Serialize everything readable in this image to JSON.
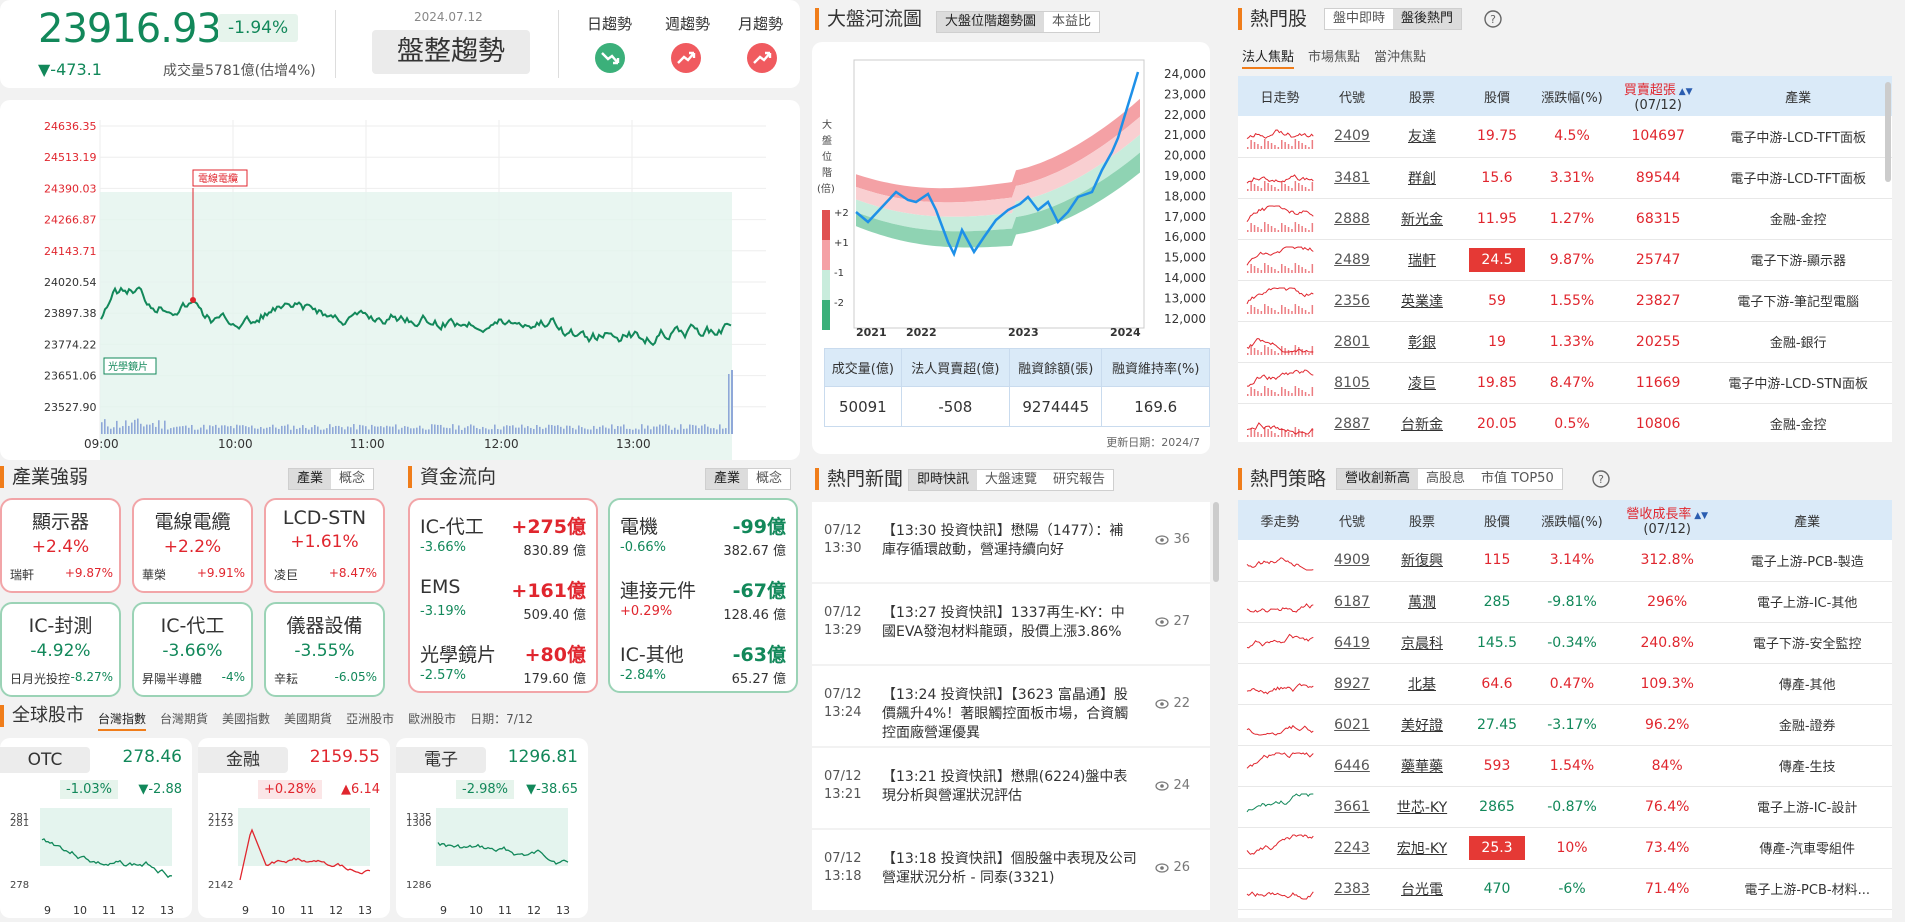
{
  "market": {
    "index": "23916.93",
    "pct": "-1.94%",
    "change": "▼-473.1",
    "volume": "成交量5781億(估增4%)",
    "date": "2024.07.12",
    "trend_label": "盤整趨勢",
    "trends": [
      {
        "label": "日趨勢",
        "dir": "down",
        "color": "#3bb07a"
      },
      {
        "label": "週趨勢",
        "dir": "up",
        "color": "#f05a5f"
      },
      {
        "label": "月趨勢",
        "dir": "up",
        "color": "#f05a5f"
      }
    ]
  },
  "intraday": {
    "y_ticks": [
      "24636.35",
      "24513.19",
      "24390.03",
      "24266.87",
      "24143.71",
      "24020.54",
      "23897.38",
      "23774.22",
      "23651.06",
      "23527.90"
    ],
    "x_ticks": [
      "09:00",
      "10:00",
      "11:00",
      "12:00",
      "13:00"
    ],
    "tag1": "電線電纜",
    "tag2": "光學鏡片"
  },
  "river": {
    "title": "大盤河流圖",
    "tabs": [
      "大盤位階趨勢圖",
      "本益比"
    ],
    "y_ticks": [
      "24,000",
      "23,000",
      "22,000",
      "21,000",
      "20,000",
      "19,000",
      "18,000",
      "17,000",
      "16,000",
      "15,000",
      "14,000",
      "13,000",
      "12,000"
    ],
    "x_ticks": [
      "2021",
      "2022",
      "2023",
      "2024"
    ],
    "legend_title": "大盤位階(倍)",
    "legend": [
      "+2",
      "+1",
      "-1",
      "-2"
    ],
    "table_head": [
      "成交量(億)",
      "法人買賣超(億)",
      "融資餘額(張)",
      "融資維持率(%)"
    ],
    "table_vals": [
      "50091",
      "-508",
      "9274445",
      "169.6"
    ],
    "update": "更新日期：2024/7"
  },
  "hot": {
    "title": "熱門股",
    "tabs": [
      "盤中即時",
      "盤後熱門"
    ],
    "subtabs": [
      "法人焦點",
      "市場焦點",
      "當沖焦點"
    ],
    "head": [
      "日走勢",
      "代號",
      "股票",
      "股價",
      "漲跌幅(%)",
      "買賣超張",
      "(07/12)",
      "產業"
    ],
    "rows": [
      [
        "2409",
        "友達",
        "19.75",
        "4.5%",
        "104697",
        "電子中游-LCD-TFT面板"
      ],
      [
        "3481",
        "群創",
        "15.6",
        "3.31%",
        "89544",
        "電子中游-LCD-TFT面板"
      ],
      [
        "2888",
        "新光金",
        "11.95",
        "1.27%",
        "68315",
        "金融-金控"
      ],
      [
        "2489",
        "瑞軒",
        "24.5",
        "9.87%",
        "25747",
        "電子下游-顯示器"
      ],
      [
        "2356",
        "英業達",
        "59",
        "1.55%",
        "23827",
        "電子下游-筆記型電腦"
      ],
      [
        "2801",
        "彰銀",
        "19",
        "1.33%",
        "20255",
        "金融-銀行"
      ],
      [
        "8105",
        "凌巨",
        "19.85",
        "8.47%",
        "11669",
        "電子中游-LCD-STN面板"
      ],
      [
        "2887",
        "台新金",
        "20.05",
        "0.5%",
        "10806",
        "金融-金控"
      ]
    ]
  },
  "strategy": {
    "title": "熱門策略",
    "tabs": [
      "營收創新高",
      "高股息",
      "市值 TOP50"
    ],
    "head": [
      "季走勢",
      "代號",
      "股票",
      "股價",
      "漲跌幅(%)",
      "營收成長率",
      "(07/12)",
      "產業"
    ],
    "rows": [
      [
        "4909",
        "新復興",
        "115",
        "3.14%",
        "312.8%",
        "電子上游-PCB-製造"
      ],
      [
        "6187",
        "萬潤",
        "285",
        "-9.81%",
        "296%",
        "電子上游-IC-其他"
      ],
      [
        "6419",
        "京晨科",
        "145.5",
        "-0.34%",
        "240.8%",
        "電子下游-安全監控"
      ],
      [
        "8927",
        "北基",
        "64.6",
        "0.47%",
        "109.3%",
        "傳產-其他"
      ],
      [
        "6021",
        "美好證",
        "27.45",
        "-3.17%",
        "96.2%",
        "金融-證券"
      ],
      [
        "6446",
        "藥華藥",
        "593",
        "1.54%",
        "84%",
        "傳產-生技"
      ],
      [
        "3661",
        "世芯-KY",
        "2865",
        "-0.87%",
        "76.4%",
        "電子上游-IC-設計"
      ],
      [
        "2243",
        "宏旭-KY",
        "25.3",
        "10%",
        "73.4%",
        "傳產-汽車零組件"
      ],
      [
        "2383",
        "台光電",
        "470",
        "-6%",
        "71.4%",
        "電子上游-PCB-材料..."
      ]
    ]
  },
  "industry": {
    "title": "產業強弱",
    "tabs": [
      "產業",
      "概念"
    ],
    "cards": [
      [
        "顯示器",
        "+2.4%",
        "瑞軒",
        "+9.87%"
      ],
      [
        "電線電纜",
        "+2.2%",
        "華榮",
        "+9.91%"
      ],
      [
        "LCD-STN",
        "+1.61%",
        "凌巨",
        "+8.47%"
      ],
      [
        "IC-封測",
        "-4.92%",
        "日月光投控",
        "-8.27%"
      ],
      [
        "IC-代工",
        "-3.66%",
        "昇陽半導體",
        "-4%"
      ],
      [
        "儀器設備",
        "-3.55%",
        "辛耘",
        "-6.05%"
      ]
    ]
  },
  "flow": {
    "title": "資金流向",
    "tabs": [
      "產業",
      "概念"
    ],
    "inflow": [
      [
        "IC-代工",
        "+275億",
        "-3.66%",
        "830.89 億"
      ],
      [
        "EMS",
        "+161億",
        "-3.19%",
        "509.40 億"
      ],
      [
        "光學鏡片",
        "+80億",
        "-2.57%",
        "179.60 億"
      ]
    ],
    "outflow": [
      [
        "電機",
        "-99億",
        "-0.66%",
        "382.67 億"
      ],
      [
        "連接元件",
        "-67億",
        "+0.29%",
        "128.46 億"
      ],
      [
        "IC-其他",
        "-63億",
        "-2.84%",
        "65.27 億"
      ]
    ]
  },
  "news": {
    "title": "熱門新聞",
    "tabs": [
      "即時快訊",
      "大盤速覽",
      "研究報告"
    ],
    "items": [
      [
        "07/12",
        "13:30",
        "【13:30 投資快訊】懋陽（1477）：補庫存循環啟動，營運持續向好",
        "36"
      ],
      [
        "07/12",
        "13:29",
        "【13:27 投資快訊】1337再生-KY：中國EVA發泡材料龍頭，股價上漲3.86%",
        "27"
      ],
      [
        "07/12",
        "13:24",
        "【13:24 投資快訊】【3623 富晶通】股價飆升4%！著眼觸控面板市場，合資觸控面廠營運優異",
        "22"
      ],
      [
        "07/12",
        "13:21",
        "【13:21 投資快訊】懋鼎(6224)盤中表現分析與營運狀況評估",
        "24"
      ],
      [
        "07/12",
        "13:18",
        "【13:18 投資快訊】個股盤中表現及公司營運狀況分析 - 同泰(3321)",
        "26"
      ]
    ]
  },
  "global": {
    "title": "全球股市",
    "tabs": [
      "台灣指數",
      "台灣期貨",
      "美國指數",
      "美國期貨",
      "亞洲股市",
      "歐洲股市"
    ],
    "date": "日期：7/12",
    "cards": [
      {
        "name": "OTC",
        "price": "278.46",
        "pct": "-1.03%",
        "chg": "▼-2.88",
        "y": [
          "281",
          "281",
          "278"
        ],
        "dir": "down"
      },
      {
        "name": "金融",
        "price": "2159.55",
        "pct": "+0.28%",
        "chg": "▲6.14",
        "y": [
          "2172",
          "2153",
          "2142"
        ],
        "dir": "up"
      },
      {
        "name": "電子",
        "price": "1296.81",
        "pct": "-2.98%",
        "chg": "▼-38.65",
        "y": [
          "1335",
          "1306",
          "1286"
        ],
        "dir": "down"
      }
    ],
    "x": [
      "9",
      "10",
      "11",
      "12",
      "13"
    ]
  }
}
